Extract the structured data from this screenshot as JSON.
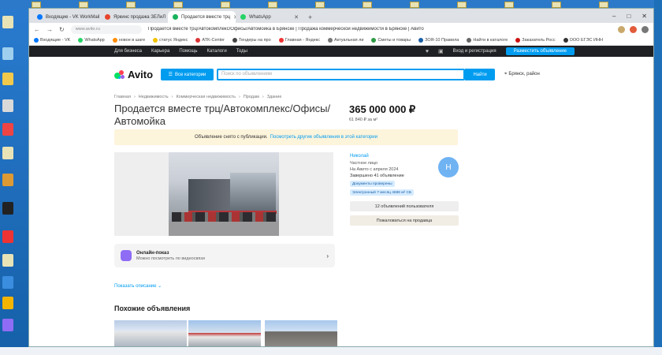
{
  "browser": {
    "tabs": [
      {
        "label": "Входящие - VK WorkMail",
        "color": "#0077ff"
      },
      {
        "label": "Яркинс продажа ЗЕЛиЛ",
        "color": "#e8452c"
      },
      {
        "label": "Продается вместе трц",
        "color": "#17b35b",
        "active": true
      },
      {
        "label": "WhatsApp",
        "color": "#25d366"
      }
    ],
    "new_tab": "+",
    "url": "www.avito.ru",
    "page_caption": "Продается вместе трц/Автокомплекс/Офисы/Автомойка в Брянске | Продажа коммерческой недвижимости в Брянске | Авито",
    "window_controls": [
      "–",
      "□",
      "✕"
    ],
    "bookmarks": [
      {
        "label": "Входящие - VK",
        "color": "#0077ff"
      },
      {
        "label": "WhatsApp",
        "color": "#25d366"
      },
      {
        "label": "новое в шаге",
        "color": "#ff8c00"
      },
      {
        "label": "статус Яндекс",
        "color": "#f2c200"
      },
      {
        "label": "ATK-Center",
        "color": "#d33"
      },
      {
        "label": "Тендеры на про",
        "color": "#444"
      },
      {
        "label": "Главная - Яндекс",
        "color": "#e33"
      },
      {
        "label": "Актуальная ли",
        "color": "#777"
      },
      {
        "label": "Сметы и товары",
        "color": "#2e9b44"
      },
      {
        "label": "ЗОЯ-10 Правила",
        "color": "#1a5fa5"
      },
      {
        "label": "Найти в каталоге",
        "color": "#666"
      },
      {
        "label": "Заказатель Росс",
        "color": "#c11"
      },
      {
        "label": "ООО ЕГЭС ИНН",
        "color": "#333"
      }
    ]
  },
  "avito_nav": {
    "links": [
      "Для бизнеса",
      "Карьера",
      "Помощь",
      "Каталоги",
      "Тоды"
    ],
    "login": "Вход и регистрация",
    "post_ad": "Разместить объявление"
  },
  "header": {
    "logo": "Avito",
    "categories_button": "Все категории",
    "search_placeholder": "Поиск по объявлениям",
    "search_button": "Найти",
    "location": "Брянск, район"
  },
  "listing": {
    "breadcrumbs": [
      "Главная",
      "Недвижимость",
      "Коммерческая недвижимость",
      "Продам",
      "Здание"
    ],
    "title": "Продается вместе трц/Автокомплекс/Офисы/Автомойка",
    "price": "365 000 000 ₽",
    "price_per_m2": "61 840 ₽ за м²",
    "closed_notice": "Объявление снято с публикации.",
    "closed_link": "Посмотреть другие объявления в этой категории",
    "online_show_title": "Онлайн-показ",
    "online_show_sub": "Можно посмотреть по видеосвязи",
    "show_description": "Показать описание ⌄",
    "similar_title": "Похожие объявления"
  },
  "seller": {
    "name": "Николай",
    "type": "Частное лицо",
    "since": "На Авито с апреля 2024",
    "completed": "Завершено 41 объявление",
    "badge_docs": "Документы проверены",
    "badge_rating": "Электронный 7 месяц 4686 м² СБ",
    "avatar_letter": "Н",
    "ads_button": "12 объявлений пользователя",
    "complain_button": "Пожаловаться на продавца"
  },
  "colors": {
    "avito_blue": "#009cf0",
    "nav_dark": "#1f2023",
    "banner": "#fdf4dc"
  }
}
